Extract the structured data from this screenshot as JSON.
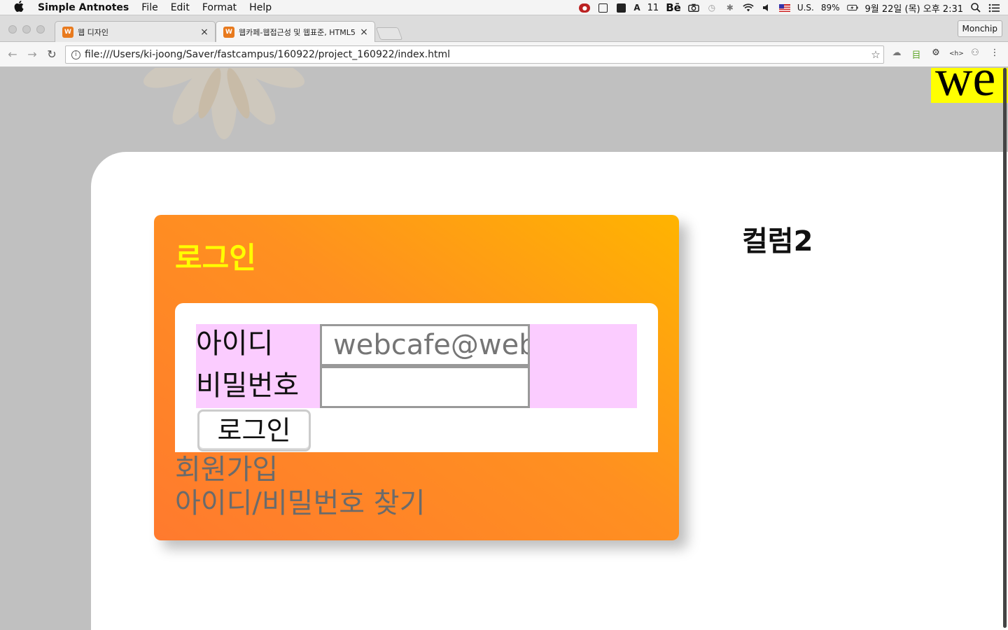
{
  "menubar": {
    "apple": "",
    "app_name": "Simple Antnotes",
    "items": [
      "File",
      "Edit",
      "Format",
      "Help"
    ],
    "status": {
      "counter": "11",
      "behance": "Bē",
      "input_source": "U.S.",
      "battery": "89%",
      "datetime": "9월 22일 (목) 오후 2:31"
    }
  },
  "browser": {
    "tabs": [
      {
        "label": "웹 디자인",
        "close": "×"
      },
      {
        "label": "웹카페-웹접근성 및 웹표준, HTML5",
        "close": "×"
      }
    ],
    "profile": "Monchip",
    "nav": {
      "back": "←",
      "forward": "→",
      "reload": "↻"
    },
    "url": "file:///Users/ki-joong/Saver/fastcampus/160922/project_160922/index.html",
    "star": "☆",
    "extensions": [
      "☁",
      "目",
      "⚙",
      "<h>",
      "⚇",
      "⋮"
    ]
  },
  "page": {
    "brand_text": "we",
    "login": {
      "title": "로그인",
      "id_label": "아이디",
      "id_placeholder": "webcafe@webcafe.com",
      "password_label": "비밀번호",
      "password_value": "",
      "button_label": "로그인",
      "signup_link": "회원가입",
      "find_link": "아이디/비밀번호 찾기"
    },
    "column2_title": "컬럼2"
  },
  "colors": {
    "background": "#c0c0c0",
    "brand_highlight": "#ffff00",
    "card_gradient_start": "#ff7a2e",
    "card_gradient_end": "#ffb400",
    "title_color": "#ffff00",
    "form_bg": "#fbccff",
    "link_color": "#6b6b6b"
  }
}
